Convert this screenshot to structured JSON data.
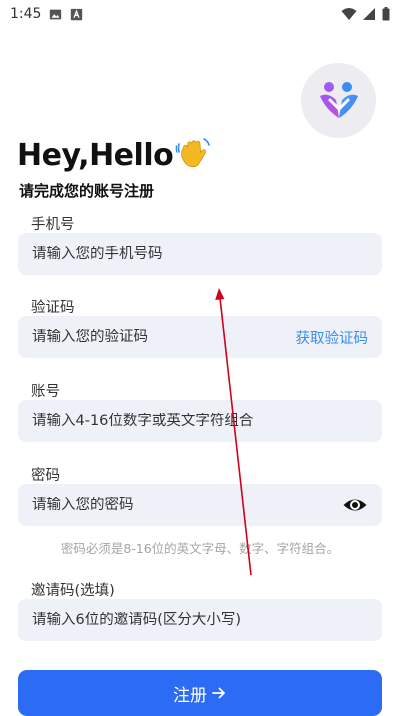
{
  "status_bar": {
    "time": "1:45",
    "icons": [
      "image-icon",
      "a-box-icon",
      "wifi-icon",
      "signal-icon",
      "battery-icon"
    ]
  },
  "header": {
    "logo": "heart-people-logo",
    "greeting": "Hey,Hello",
    "greeting_icon": "waving-hand-icon",
    "subtitle": "请完成您的账号注册"
  },
  "form": {
    "phone": {
      "label": "手机号",
      "placeholder": "请输入您的手机号码"
    },
    "code": {
      "label": "验证码",
      "placeholder": "请输入您的验证码",
      "action": "获取验证码"
    },
    "account": {
      "label": "账号",
      "placeholder": "请输入4-16位数字或英文字符组合"
    },
    "password": {
      "label": "密码",
      "placeholder": "请输入您的密码",
      "toggle_icon": "eye-icon",
      "hint": "密码必须是8-16位的英文字母、数字、字符组合。"
    },
    "invite": {
      "label": "邀请码(选填)",
      "placeholder": "请输入6位的邀请码(区分大小写)"
    }
  },
  "register_button": {
    "label": "注册",
    "icon": "arrow-right-icon"
  },
  "colors": {
    "accent": "#2c6bf4",
    "link": "#3a8df0",
    "field_bg": "#eef1f7",
    "annotation_arrow": "#d0021b"
  }
}
